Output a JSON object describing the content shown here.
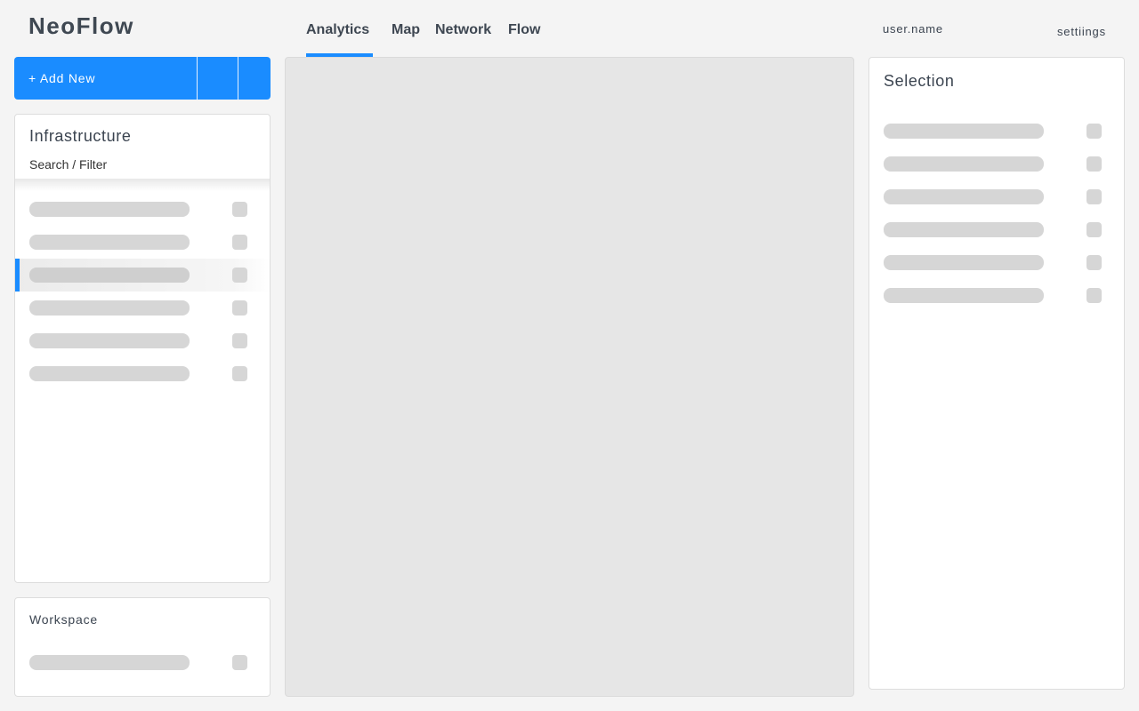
{
  "app": {
    "name": "NeoFlow"
  },
  "nav": {
    "tabs": [
      {
        "label": "Analytics",
        "active": true
      },
      {
        "label": "Map",
        "active": false
      },
      {
        "label": "Network",
        "active": false
      },
      {
        "label": "Flow",
        "active": false
      }
    ]
  },
  "header": {
    "user_name": "user.name",
    "settings_label": "settiings"
  },
  "toolbar": {
    "add_label": "+ Add New"
  },
  "infrastructure": {
    "title": "Infrastructure",
    "search_label": "Search / Filter",
    "selected_index": 2,
    "items_count": 6
  },
  "workspace": {
    "title": "Workspace",
    "items_count": 1
  },
  "selection": {
    "title": "Selection",
    "items_count": 6
  },
  "colors": {
    "accent": "#1a8cff",
    "placeholder": "#d6d6d6",
    "canvas": "#e6e6e6",
    "background": "#f4f4f4"
  }
}
